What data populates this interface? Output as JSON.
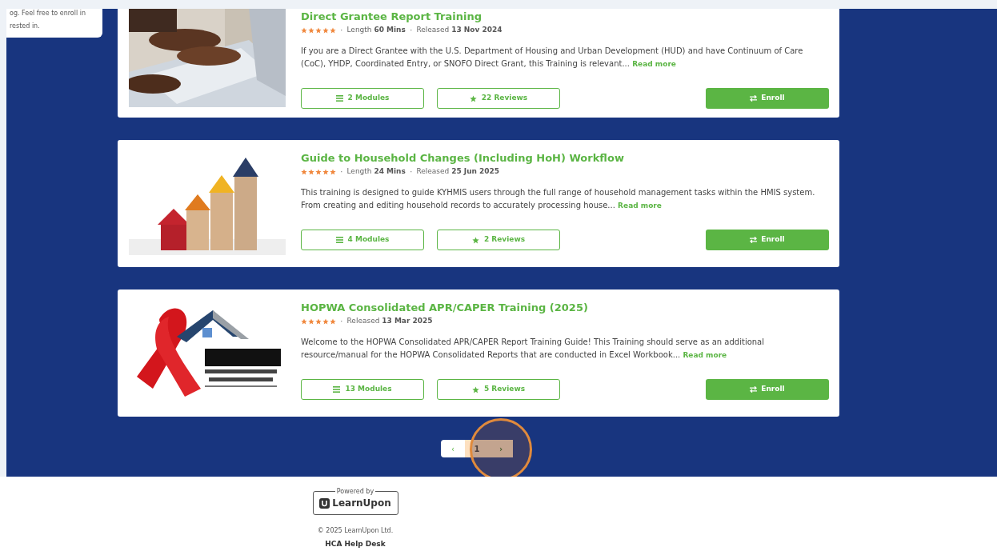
{
  "side_note": {
    "lines": [
      "og. Feel free to enroll in",
      "rested in."
    ]
  },
  "courses": [
    {
      "title": "Direct Grantee Report Training",
      "stars": 5,
      "meta": [
        {
          "separator": "·",
          "label": "Length",
          "value": "60 Mins"
        },
        {
          "separator": "·",
          "label": "Released",
          "value": "13 Nov 2024"
        }
      ],
      "description": "If you are a Direct Grantee with the U.S. Department of Housing and Urban Development (HUD) and have Continuum of Care (CoC), YHDP, Coordinated Entry, or SNOFO Direct Grant, this Training is relevant...",
      "read_more": "Read more",
      "modules": "2 Modules",
      "reviews": "22 Reviews",
      "enroll": "Enroll"
    },
    {
      "title": "Guide to Household Changes (Including HoH) Workflow",
      "stars": 5,
      "meta": [
        {
          "separator": "·",
          "label": "Length",
          "value": "24 Mins"
        },
        {
          "separator": "·",
          "label": "Released",
          "value": "25 Jun 2025"
        }
      ],
      "description": "This training is designed to guide KYHMIS users through the full range of household management tasks within the HMIS system. From creating and editing household records to accurately processing house...",
      "read_more": "Read more",
      "modules": "4 Modules",
      "reviews": "2 Reviews",
      "enroll": "Enroll"
    },
    {
      "title": "HOPWA Consolidated APR/CAPER Training (2025)",
      "stars": 5,
      "meta": [
        {
          "separator": "·",
          "label": "Released",
          "value": "13 Mar 2025"
        }
      ],
      "description": "Welcome to the HOPWA Consolidated APR/CAPER Report Training Guide! This Training should serve as an additional resource/manual for the HOPWA Consolidated Reports that are conducted in Excel Workbook...",
      "read_more": "Read more",
      "modules": "13 Modules",
      "reviews": "5 Reviews",
      "enroll": "Enroll"
    }
  ],
  "pagination": [
    {
      "kind": "prev",
      "label": "‹",
      "selected": false
    },
    {
      "kind": "page",
      "label": "1",
      "selected": true
    },
    {
      "kind": "next",
      "label": "›",
      "selected": false
    }
  ],
  "footer": {
    "powered_by": "Powered by",
    "brand": "LearnUpon",
    "copyright": "© 2025 LearnUpon Ltd.",
    "help": "HCA Help Desk"
  }
}
